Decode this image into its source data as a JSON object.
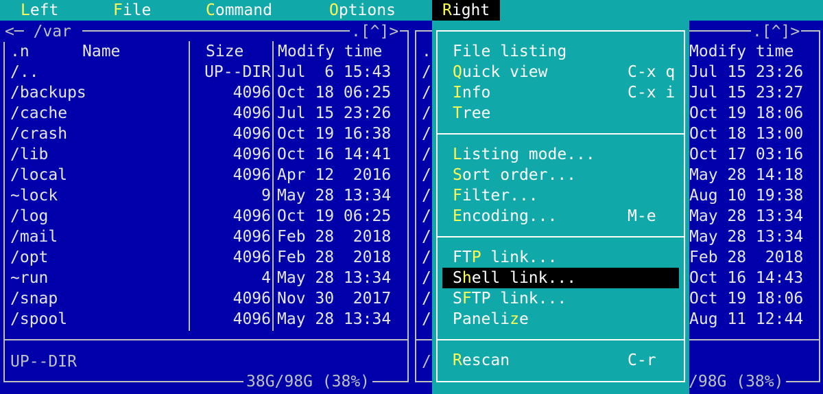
{
  "menubar": {
    "left": {
      "hot": "L",
      "rest": "eft"
    },
    "file": {
      "hot": "F",
      "rest": "ile"
    },
    "command": {
      "hot": "C",
      "rest": "ommand"
    },
    "options": {
      "hot": "O",
      "rest": "ptions"
    },
    "right": {
      "hot": "R",
      "rest": "ight"
    }
  },
  "left_panel": {
    "title": "<─ /var ",
    "corner_right": ".[^]>",
    "columns": {
      "n": ".n",
      "name": "Name",
      "size": "Size",
      "mtime": "Modify time"
    },
    "rows": [
      {
        "name": "/..",
        "size": "UP--DIR",
        "date": "Jul  6 15:43"
      },
      {
        "name": "/backups",
        "size": "4096",
        "date": "Oct 18 06:25"
      },
      {
        "name": "/cache",
        "size": "4096",
        "date": "Jul 15 23:26"
      },
      {
        "name": "/crash",
        "size": "4096",
        "date": "Oct 19 16:38"
      },
      {
        "name": "/lib",
        "size": "4096",
        "date": "Oct 16 14:41"
      },
      {
        "name": "/local",
        "size": "4096",
        "date": "Apr 12  2016"
      },
      {
        "name": "~lock",
        "size": "9",
        "date": "May 28 13:34"
      },
      {
        "name": "/log",
        "size": "4096",
        "date": "Oct 19 06:25"
      },
      {
        "name": "/mail",
        "size": "4096",
        "date": "Feb 28  2018"
      },
      {
        "name": "/opt",
        "size": "4096",
        "date": "Feb 28  2018"
      },
      {
        "name": "~run",
        "size": "4",
        "date": "May 28 13:34"
      },
      {
        "name": "/snap",
        "size": "4096",
        "date": "Nov 30  2017"
      },
      {
        "name": "/spool",
        "size": "4096",
        "date": "May 28 13:34"
      }
    ],
    "status": "UP--DIR",
    "footer": "38G/98G (38%)"
  },
  "right_panel": {
    "corner_right": ".[^]>",
    "col_mtime": "Modify time",
    "left_stub_rows": [
      ".",
      "/",
      "/",
      "/",
      "/",
      "/",
      "/",
      "/",
      "/",
      "/",
      "/",
      "/",
      "/",
      "/"
    ],
    "dates": [
      "Jul 15 23:26",
      "Jul 15 23:27",
      "Oct 19 18:06",
      "Oct 18 13:00",
      "Oct 17 03:16",
      "May 28 14:18",
      "Aug 10 19:38",
      "May 28 13:34",
      "May 28 13:34",
      "Feb 28  2018",
      "Oct 16 14:43",
      "Oct 19 18:06",
      "Aug 11 12:44"
    ],
    "status_stub": "/",
    "footer": "/98G (38%)"
  },
  "dropdown": {
    "groups": [
      [
        {
          "pre": "File listing",
          "hot": "",
          "post": "",
          "shortcut": ""
        },
        {
          "pre": "",
          "hot": "Q",
          "post": "uick view",
          "shortcut": "C-x q"
        },
        {
          "pre": "",
          "hot": "I",
          "post": "nfo",
          "shortcut": "C-x i"
        },
        {
          "pre": "",
          "hot": "T",
          "post": "ree",
          "shortcut": ""
        }
      ],
      [
        {
          "pre": "",
          "hot": "L",
          "post": "isting mode...",
          "shortcut": ""
        },
        {
          "pre": "",
          "hot": "S",
          "post": "ort order...",
          "shortcut": ""
        },
        {
          "pre": "",
          "hot": "F",
          "post": "ilter...",
          "shortcut": ""
        },
        {
          "pre": "",
          "hot": "E",
          "post": "ncoding...",
          "shortcut": "M-e"
        }
      ],
      [
        {
          "pre": "FT",
          "hot": "P",
          "post": " link...",
          "shortcut": ""
        },
        {
          "pre": "S",
          "hot": "h",
          "post": "ell link...",
          "shortcut": ""
        },
        {
          "pre": "S",
          "hot": "F",
          "post": "TP link...",
          "shortcut": ""
        },
        {
          "pre": "Paneli",
          "hot": "z",
          "post": "e",
          "shortcut": ""
        }
      ],
      [
        {
          "pre": "",
          "hot": "R",
          "post": "escan",
          "shortcut": "C-r"
        }
      ]
    ],
    "selected": "Shell link..."
  },
  "colors": {
    "panel_bg": "#0000aa",
    "menu_bg": "#10a8a8",
    "hotkey": "#ffff55",
    "selection_bg": "#000000"
  }
}
